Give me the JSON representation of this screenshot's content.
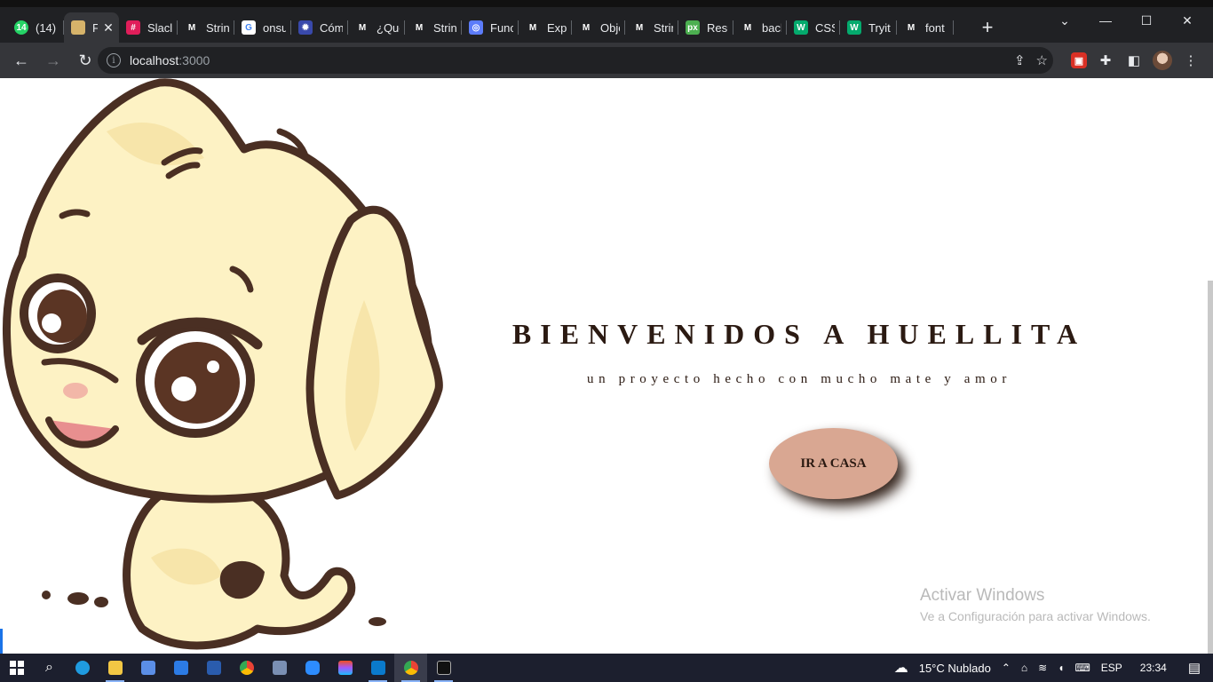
{
  "browser": {
    "tabs": [
      {
        "label": "(14)",
        "icon": "whatsapp-icon",
        "color": "#25d366",
        "glyph": "14"
      },
      {
        "label": "F",
        "icon": "dog-favicon-icon",
        "color": "#d6b36a",
        "glyph": "",
        "active": true
      },
      {
        "label": "Slacl",
        "icon": "slack-icon",
        "color": "#e01e5a",
        "glyph": "#"
      },
      {
        "label": "Strin",
        "icon": "mdn-icon",
        "color": "#202124",
        "glyph": "M"
      },
      {
        "label": "onsu",
        "icon": "google-icon",
        "color": "#ffffff",
        "glyph": "G"
      },
      {
        "label": "Cóm",
        "icon": "gear-site-icon",
        "color": "#3949ab",
        "glyph": "✹"
      },
      {
        "label": "¿Qué",
        "icon": "mdn-icon",
        "color": "#202124",
        "glyph": "M"
      },
      {
        "label": "Strin",
        "icon": "mdn-icon",
        "color": "#202124",
        "glyph": "M"
      },
      {
        "label": "Func",
        "icon": "circle-site-icon",
        "color": "#5c7cfa",
        "glyph": "◎"
      },
      {
        "label": "Expr",
        "icon": "mdn-icon",
        "color": "#202124",
        "glyph": "M"
      },
      {
        "label": "Obje",
        "icon": "mdn-icon",
        "color": "#202124",
        "glyph": "M"
      },
      {
        "label": "Strin",
        "icon": "mdn-icon",
        "color": "#202124",
        "glyph": "M"
      },
      {
        "label": "Resu",
        "icon": "px-icon",
        "color": "#4caf50",
        "glyph": "px"
      },
      {
        "label": "back",
        "icon": "mdn-icon",
        "color": "#202124",
        "glyph": "M"
      },
      {
        "label": "CSS",
        "icon": "w3schools-icon",
        "color": "#04aa6d",
        "glyph": "W"
      },
      {
        "label": "Tryit",
        "icon": "w3schools-icon",
        "color": "#04aa6d",
        "glyph": "W"
      },
      {
        "label": "font",
        "icon": "mdn-icon",
        "color": "#202124",
        "glyph": "M"
      }
    ],
    "url_host": "localhost",
    "url_port": ":3000"
  },
  "page": {
    "title": "BIENVENIDOS A HUELLITA",
    "subtitle": "un proyecto hecho con mucho mate y amor",
    "cta_label": "IR A CASA",
    "cta_color": "#d9a792",
    "text_color": "#2b1a12"
  },
  "watermark": {
    "line1": "Activar Windows",
    "line2": "Ve a Configuración para activar Windows."
  },
  "taskbar": {
    "weather": "15°C  Nublado",
    "lang": "ESP",
    "time": "23:34"
  }
}
